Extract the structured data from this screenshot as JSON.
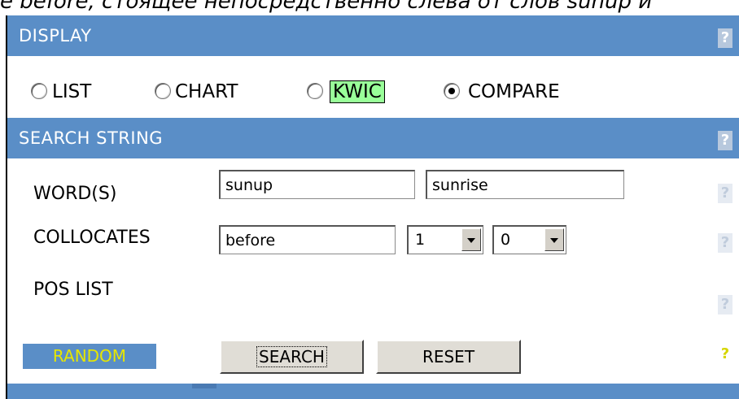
{
  "header": {
    "caption": "e before, стоящее непосредственно слева от слов sunup и"
  },
  "display": {
    "title": "DISPLAY",
    "help": "?",
    "options": [
      {
        "label": "LIST",
        "selected": false
      },
      {
        "label": "CHART",
        "selected": false
      },
      {
        "label": "KWIC",
        "selected": false
      },
      {
        "label": "COMPARE",
        "selected": true
      }
    ],
    "kwic_highlight_color": "#99ff99"
  },
  "search_string": {
    "title": "SEARCH STRING",
    "help": "?",
    "words_label": "WORD(S)",
    "word1_value": "sunup",
    "word2_value": "sunrise",
    "collocates_label": "COLLOCATES",
    "collocate_value": "before",
    "span_left": "1",
    "span_right": "0",
    "pos_list_label": "POS LIST",
    "random_label": "RANDOM",
    "search_button": "SEARCH",
    "reset_button": "RESET",
    "row_help": "?"
  },
  "colors": {
    "bar": "#5a8ec7",
    "random_text": "#e6e600"
  }
}
